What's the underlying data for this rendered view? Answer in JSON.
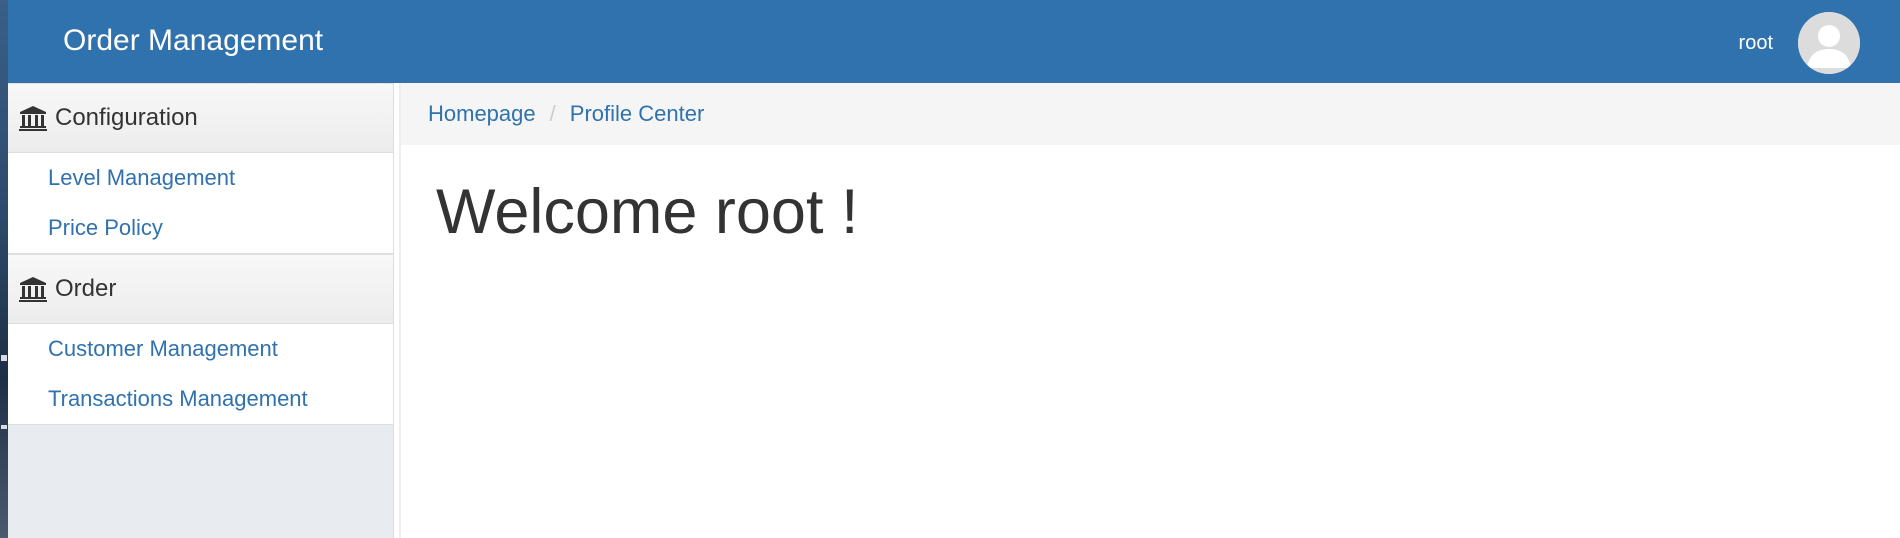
{
  "header": {
    "brand": "Order Management",
    "username": "root",
    "background_color": "#3072ad"
  },
  "sidebar": {
    "groups": [
      {
        "title": "Configuration",
        "icon": "bank-icon",
        "items": [
          {
            "label": "Level Management"
          },
          {
            "label": "Price Policy"
          }
        ]
      },
      {
        "title": "Order",
        "icon": "bank-icon",
        "items": [
          {
            "label": "Customer Management"
          },
          {
            "label": "Transactions Management"
          }
        ]
      }
    ]
  },
  "breadcrumb": {
    "items": [
      {
        "label": "Homepage"
      },
      {
        "label": "Profile Center"
      }
    ],
    "separator": "/"
  },
  "main": {
    "welcome": "Welcome root !"
  },
  "colors": {
    "link": "#3072ad",
    "text": "#333333",
    "sidebar_bg": "#e8ebef"
  }
}
